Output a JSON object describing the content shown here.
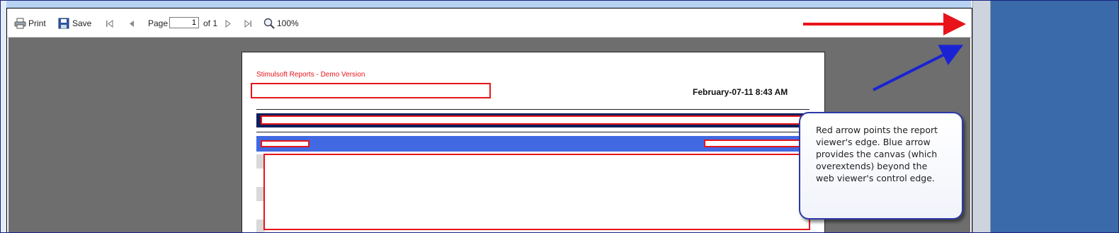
{
  "toolbar": {
    "print_label": "Print",
    "save_label": "Save",
    "page_label": "Page",
    "page_value": "1",
    "page_of": "of 1",
    "zoom_label": "100%"
  },
  "report": {
    "demo_text": "Stimulsoft Reports - Demo Version",
    "date_text": "February-07-11 8:43 AM"
  },
  "callout": {
    "text": "Red arrow points the report viewer's edge. Blue arrow provides the canvas (which overextends) beyond the web viewer's control edge."
  },
  "annotations": {
    "red_arrow_color": "#e8141a",
    "blue_arrow_color": "#1a23d4"
  },
  "icons": [
    "print-icon",
    "save-icon",
    "first-page-icon",
    "prev-page-icon",
    "next-page-icon",
    "last-page-icon",
    "zoom-icon"
  ]
}
